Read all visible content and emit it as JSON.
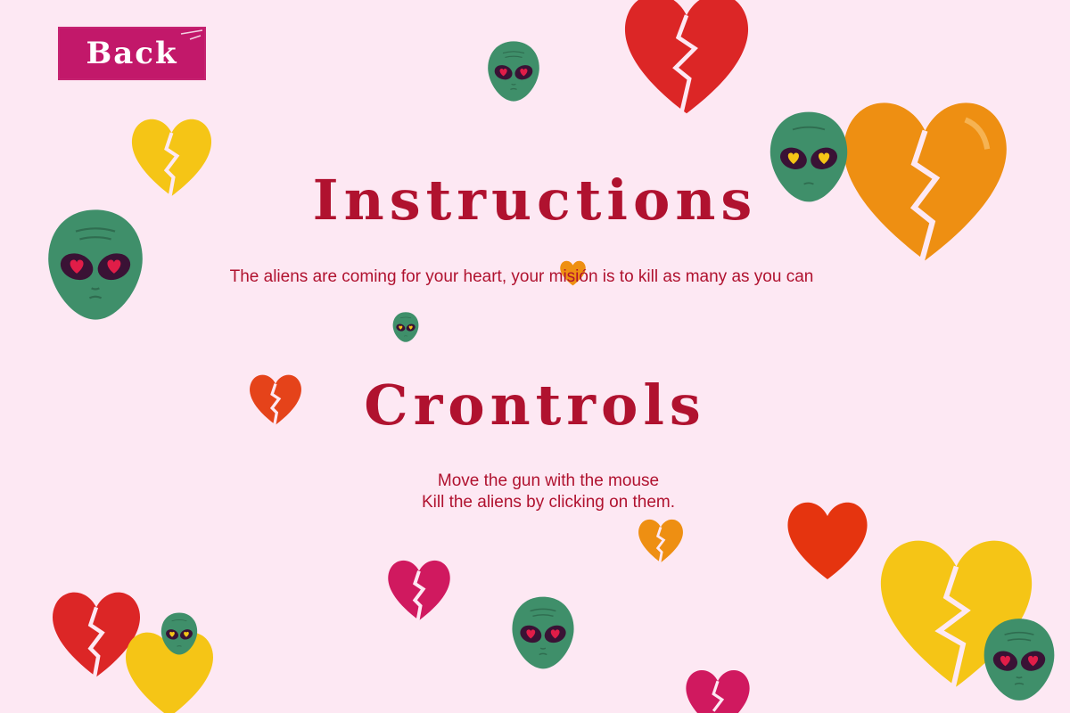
{
  "back_button": {
    "label": "Back"
  },
  "instructions": {
    "heading": "Instructions",
    "text": "The aliens are coming for your heart, your misión is to kill as many as you can"
  },
  "controls": {
    "heading": "Crontrols",
    "lines": [
      "Move the gun with the mouse",
      "Kill the aliens by clicking on them."
    ]
  },
  "colors": {
    "background": "#fde8f3",
    "accent": "#b0122f",
    "button": "#c2186a",
    "alien": "#3f8f6a",
    "heart_red": "#dc2626",
    "heart_orange": "#ee8f12",
    "heart_yellow": "#f5c516",
    "heart_magenta": "#d0195f"
  },
  "decorations": {
    "alien_icon": "alien-head-icon",
    "heart_icon": "heart-icon",
    "broken_heart_icon": "broken-heart-icon"
  }
}
